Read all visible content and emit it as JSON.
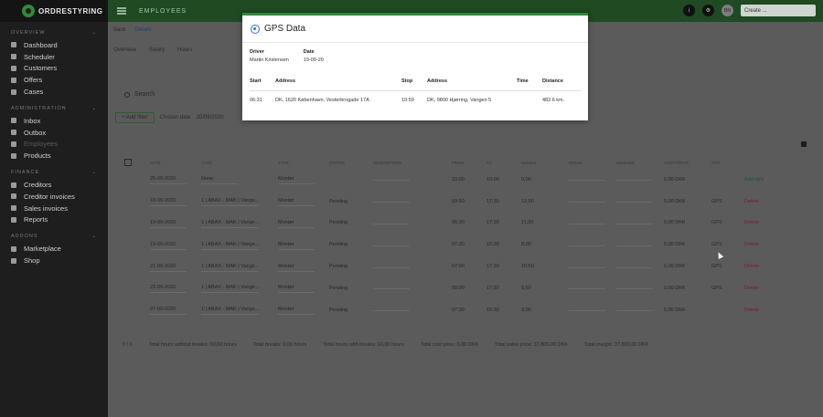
{
  "brand": "ORDRESTYRING",
  "topbar": {
    "title": "EMPLOYEES",
    "avatar": "BN",
    "create_label": "Create ...",
    "help": "i"
  },
  "sidebar": {
    "sections": [
      {
        "title": "OVERVIEW",
        "items": [
          "Dashboard",
          "Scheduler",
          "Customers",
          "Offers",
          "Cases"
        ]
      },
      {
        "title": "ADMINISTRATION",
        "items": [
          "Inbox",
          "Outbox",
          "Employees",
          "Products"
        ]
      },
      {
        "title": "FINANCE",
        "items": [
          "Creditors",
          "Creditor invoices",
          "Sales invoices",
          "Reports"
        ]
      },
      {
        "title": "ADDONS",
        "items": [
          "Marketplace",
          "Shop"
        ]
      }
    ]
  },
  "main": {
    "subnav": {
      "back": "Back",
      "details": "Details"
    },
    "tabs": [
      "Overview",
      "Salary",
      "Hours"
    ],
    "search_placeholder": "Search",
    "filters": {
      "add_filter": "+ Add filter",
      "chosen_date_label": "Chosen date",
      "chosen_date_value": "20/09/2020"
    },
    "columns": [
      "DATE",
      "CASE",
      "TYPE",
      "STATUS",
      "DESCRIPTION",
      "FROM",
      "TO",
      "HOURS",
      "BREAK",
      "MILEAGE",
      "COST PRICE",
      "GPS",
      ""
    ],
    "rows": [
      {
        "date": "25-09-2020",
        "case": "None",
        "type": "Montør",
        "status": "",
        "from": "10:00",
        "to": "10:00",
        "hours": "0,00",
        "cost": "0,00 DKK",
        "gps": "",
        "action": "Add new"
      },
      {
        "date": "18-09-2020",
        "case": "1 | ABAX - MAK | Vange...",
        "type": "Montør",
        "status": "Pending",
        "from": "09:50",
        "to": "17:30",
        "hours": "12,50",
        "cost": "0,00 DKK",
        "gps": "GPS",
        "action": "Delete"
      },
      {
        "date": "19-09-2020",
        "case": "1 | ABAX - MAK | Vange...",
        "type": "Montør",
        "status": "Pending",
        "from": "06:30",
        "to": "17:30",
        "hours": "11,00",
        "cost": "0,00 DKK",
        "gps": "GPS",
        "action": "Delete"
      },
      {
        "date": "19-09-2020",
        "case": "1 | ABAX - MAK | Vange...",
        "type": "Montør",
        "status": "Pending",
        "from": "07:30",
        "to": "15:30",
        "hours": "8,00",
        "cost": "0,00 DKK",
        "gps": "GPS",
        "action": "Delete"
      },
      {
        "date": "21-09-2020",
        "case": "1 | ABAX - MAK | Vange...",
        "type": "Montør",
        "status": "Pending",
        "from": "07:00",
        "to": "17:30",
        "hours": "10,50",
        "cost": "0,00 DKK",
        "gps": "GPS",
        "action": "Delete"
      },
      {
        "date": "22-09-2020",
        "case": "1 | ABAX - MAK | Vange...",
        "type": "Montør",
        "status": "Pending",
        "from": "08:00",
        "to": "17:30",
        "hours": "9,50",
        "cost": "0,00 DKK",
        "gps": "GPS",
        "action": "Delete"
      },
      {
        "date": "07-09-2020",
        "case": "1 | ABAX - MAK | Vange...",
        "type": "Montør",
        "status": "Pending",
        "from": "07:30",
        "to": "16:30",
        "hours": "9,00",
        "cost": "0,00 DKK",
        "gps": "",
        "action": "Delete"
      }
    ],
    "totals": [
      "0 / 6",
      "Total hours without breaks: 60,00 hours",
      "Total breaks: 0,00 hours",
      "Total hours with breaks: 60,00 hours",
      "Total cost price: 0,00 DKK",
      "Total sales price: 37.800,00 DKK",
      "Total margin: 37.800,00 DKK"
    ]
  },
  "modal": {
    "title": "GPS Data",
    "driver_label": "Driver",
    "driver_value": "Martin Kristensen",
    "date_label": "Date",
    "date_value": "19-09-20",
    "columns": [
      "Start",
      "Address",
      "Stop",
      "Address",
      "Time",
      "Distance"
    ],
    "rows": [
      {
        "start": "06:31",
        "start_address": "DK, 1620 København, Vesterbrogade 17A",
        "stop": "10:59",
        "stop_address": "DK, 9800 Hjørring, Vangen 5",
        "time": "",
        "distance": "482.6 km."
      }
    ]
  },
  "colors": {
    "accent": "#2f8a3a",
    "topbar": "#1f4a22",
    "gps_icon": "#2b6fd6"
  }
}
